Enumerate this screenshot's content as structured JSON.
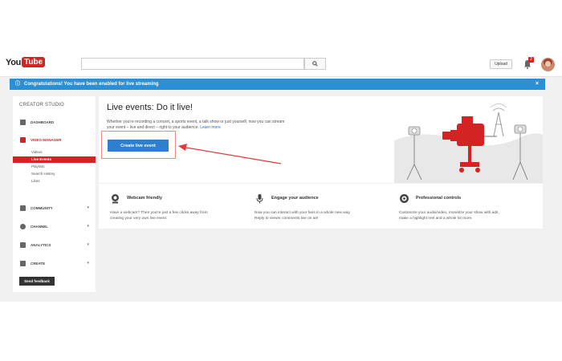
{
  "topbar": {
    "logo_you": "You",
    "logo_tube": "Tube",
    "upload_label": "Upload",
    "notification_count": "2"
  },
  "banner": {
    "text": "Congratulations! You have been enabled for live streaming",
    "close": "×"
  },
  "sidebar": {
    "title": "CREATOR STUDIO",
    "dashboard": "DASHBOARD",
    "video_manager": "VIDEO MANAGER",
    "sub_items": [
      "Videos",
      "Live Events",
      "Playlists",
      "Search History",
      "Likes"
    ],
    "community": "COMMUNITY",
    "channel": "CHANNEL",
    "analytics": "ANALYTICS",
    "create": "CREATE",
    "feedback": "Send feedback"
  },
  "main": {
    "title": "Live events: Do it live!",
    "desc": "Whether you're recording a concert, a sports event, a talk show or just yourself, now you can stream your event – live and direct – right to your audience.",
    "learn_more": "Learn more",
    "create_button": "Create live event"
  },
  "features": [
    {
      "title": "Webcam friendly",
      "desc_line1": "Have a webcam? Then you're just a few clicks away from",
      "desc_line2": "creating your very own live event."
    },
    {
      "title": "Engage your audience",
      "desc_line1": "Now you can interact with your fans in a whole new way.",
      "desc_line2": "Reply to viewer comments live on air!"
    },
    {
      "title": "Professional controls",
      "desc_line1": "Customize your audio/video, monetize your show with ads,",
      "desc_line2": "make a highlight reel and a whole lot more."
    }
  ],
  "colors": {
    "brand_red": "#d32323",
    "banner_blue": "#2b8fd6",
    "button_blue": "#2f7fcf",
    "sidebar_bg": "#ffffff",
    "page_bg": "#f1f1f1"
  },
  "icons": {
    "search": "search-icon",
    "bell": "bell-icon",
    "webcam": "webcam-icon",
    "microphone": "microphone-icon",
    "controls": "controls-icon"
  }
}
